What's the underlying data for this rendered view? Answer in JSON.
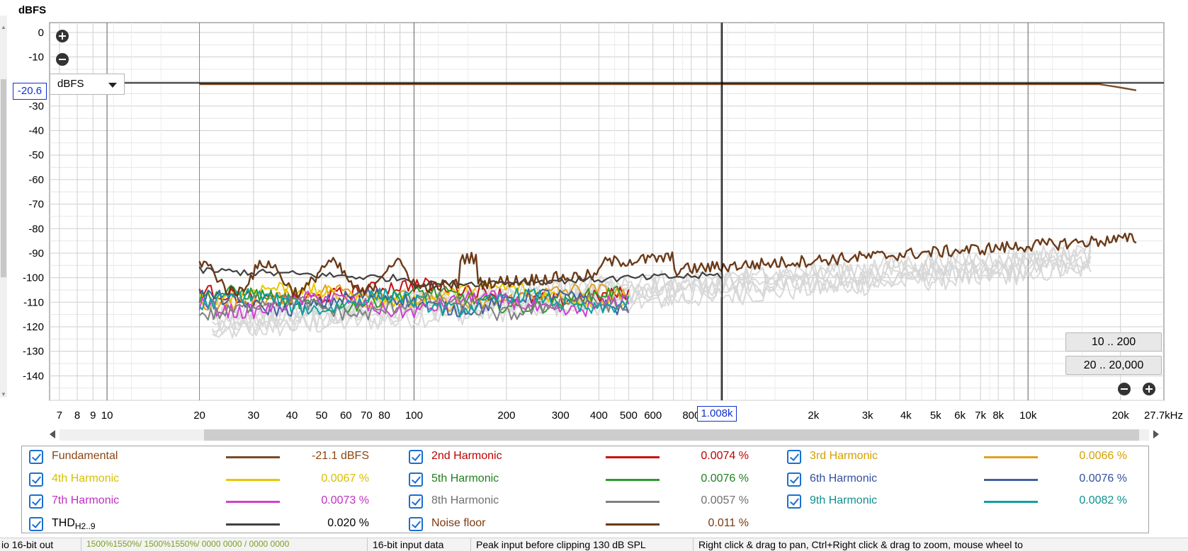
{
  "plot": {
    "y_unit_title": "dBFS",
    "y_ticks": [
      "0",
      "-10",
      "-20",
      "-30",
      "-40",
      "-50",
      "-60",
      "-70",
      "-80",
      "-90",
      "-100",
      "-110",
      "-120",
      "-130",
      "-140"
    ],
    "x_ticks": [
      {
        "label": "7",
        "f": 7
      },
      {
        "label": "8",
        "f": 8
      },
      {
        "label": "9",
        "f": 9
      },
      {
        "label": "10",
        "f": 10
      },
      {
        "label": "20",
        "f": 20
      },
      {
        "label": "30",
        "f": 30
      },
      {
        "label": "40",
        "f": 40
      },
      {
        "label": "50",
        "f": 50
      },
      {
        "label": "60",
        "f": 60
      },
      {
        "label": "70",
        "f": 70
      },
      {
        "label": "80",
        "f": 80
      },
      {
        "label": "100",
        "f": 100
      },
      {
        "label": "200",
        "f": 200
      },
      {
        "label": "300",
        "f": 300
      },
      {
        "label": "400",
        "f": 400
      },
      {
        "label": "500",
        "f": 500
      },
      {
        "label": "600",
        "f": 600
      },
      {
        "label": "800",
        "f": 800
      },
      {
        "label": "2k",
        "f": 2000
      },
      {
        "label": "3k",
        "f": 3000
      },
      {
        "label": "4k",
        "f": 4000
      },
      {
        "label": "5k",
        "f": 5000
      },
      {
        "label": "6k",
        "f": 6000
      },
      {
        "label": "7k",
        "f": 7000
      },
      {
        "label": "8k",
        "f": 8000
      },
      {
        "label": "10k",
        "f": 10000
      },
      {
        "label": "20k",
        "f": 20000
      },
      {
        "label": "27.7kHz",
        "f": 27700
      }
    ],
    "x_range_hz": [
      6.5,
      27700
    ],
    "y_range_db": [
      4,
      -150
    ],
    "unit_selector_value": "dBFS",
    "cursor_y_readout": "-20.6",
    "cursor_x_readout": "1.008k",
    "cursor_freq_hz": 1008,
    "cursor_level_db": -20.6,
    "range_buttons": [
      "10 .. 200",
      "20 .. 20,000"
    ]
  },
  "legend": [
    {
      "name": "Fundamental",
      "value": "-21.1 dBFS",
      "color": "#7b4a24",
      "text_color": "#8b4513"
    },
    {
      "name": "2nd Harmonic",
      "value": "0.0074 %",
      "color": "#c81010",
      "text_color": "#c00000"
    },
    {
      "name": "3rd Harmonic",
      "value": "0.0066 %",
      "color": "#e0a020",
      "text_color": "#d4a000"
    },
    {
      "name": "4th Harmonic",
      "value": "0.0067 %",
      "color": "#e8c800",
      "text_color": "#d8c000"
    },
    {
      "name": "5th Harmonic",
      "value": "0.0076 %",
      "color": "#2e9a2e",
      "text_color": "#208020"
    },
    {
      "name": "6th Harmonic",
      "value": "0.0076 %",
      "color": "#4060a0",
      "text_color": "#3050a0"
    },
    {
      "name": "7th Harmonic",
      "value": "0.0073 %",
      "color": "#d040d0",
      "text_color": "#c030c0"
    },
    {
      "name": "8th Harmonic",
      "value": "0.0057 %",
      "color": "#808080",
      "text_color": "#707070"
    },
    {
      "name": "9th Harmonic",
      "value": "0.0082 %",
      "color": "#10a0a0",
      "text_color": "#109090"
    },
    {
      "name": "THD",
      "name_sub": "H2..9",
      "value": "0.020 %",
      "color": "#404040",
      "text_color": "#000000"
    },
    {
      "name": "Noise floor",
      "value": "0.011 %",
      "color": "#6b3a18",
      "text_color": "#7b3a10"
    }
  ],
  "statusbar": {
    "s1": "io 16-bit out",
    "s2": "1500%1550%/ 1500%1550%/ 0000 0000 / 0000 0000",
    "s3": "16-bit input data",
    "s4": "Peak input before clipping 130 dB SPL",
    "s5": "Right click & drag to pan, Ctrl+Right click & drag to zoom, mouse wheel to"
  }
}
